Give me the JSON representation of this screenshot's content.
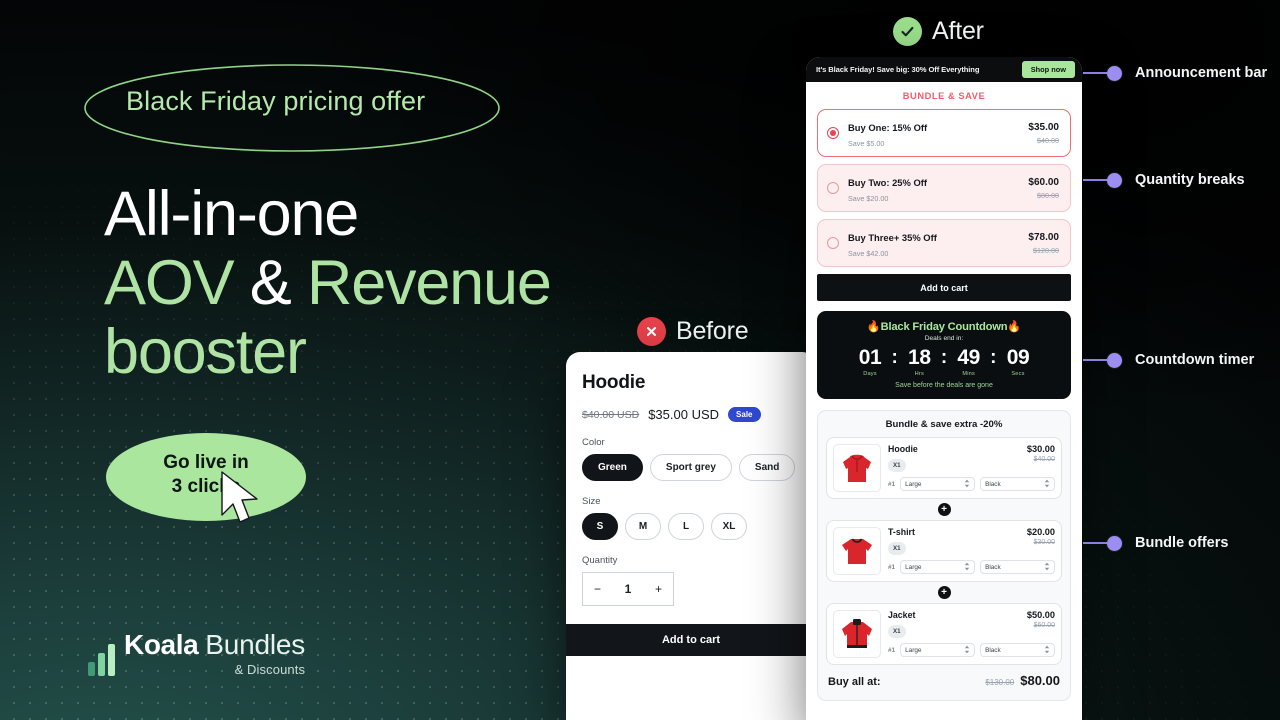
{
  "theme": {
    "bg_dark": "#050607",
    "bg_teal": "#23504a",
    "accent_green": "#abe69f",
    "accent_red": "#ee5f6a",
    "accent_purple": "#9c8ef0",
    "sale_blue": "#2e49cf"
  },
  "hero": {
    "eyebrow": "Black Friday pricing offer",
    "headline_line1": "All-in-one",
    "headline_line2a": "AOV",
    "headline_line2b": "&",
    "headline_line2c": "Revenue",
    "headline_line3": "booster",
    "pill_line1": "Go live in",
    "pill_line2": "3 clicks",
    "cursor_icon": "mouse-pointer-icon"
  },
  "logo": {
    "bars_icon": "bar-chart-icon",
    "brand_bold": "Koala",
    "brand_light": "Bundles",
    "sub": "& Discounts"
  },
  "labels": {
    "before": {
      "text": "Before",
      "icon": "x-circle-icon"
    },
    "after": {
      "text": "After",
      "icon": "check-circle-icon"
    }
  },
  "before_panel": {
    "product_title": "Hoodie",
    "price_old": "$40.00 USD",
    "price_new": "$35.00 USD",
    "sale_badge": "Sale",
    "color_label": "Color",
    "colors": [
      "Green",
      "Sport grey",
      "Sand"
    ],
    "color_selected": "Green",
    "size_label": "Size",
    "sizes": [
      "S",
      "M",
      "L",
      "XL"
    ],
    "size_selected": "S",
    "quantity_label": "Quantity",
    "quantity_minus": "−",
    "quantity_value": "1",
    "quantity_plus": "+",
    "add_to_cart": "Add to cart"
  },
  "after_panel": {
    "announcement": {
      "text": "It's Black Friday! Save big: 30% Off Everything",
      "cta": "Shop now"
    },
    "bundle_save_heading": "BUNDLE & SAVE",
    "tiers": [
      {
        "name": "Buy One: 15% Off",
        "save": "Save $5.00",
        "price": "$35.00",
        "old": "$40.00",
        "selected": true
      },
      {
        "name": "Buy Two: 25% Off",
        "save": "Save $20.00",
        "price": "$60.00",
        "old": "$80.00",
        "selected": false
      },
      {
        "name": "Buy Three+ 35% Off",
        "save": "Save $42.00",
        "price": "$78.00",
        "old": "$120.00",
        "selected": false
      }
    ],
    "add_to_cart": "Add to cart",
    "countdown": {
      "title": "🔥Black Friday Countdown🔥",
      "subtitle": "Deals end in:",
      "days": "01",
      "hrs": "18",
      "mins": "49",
      "secs": "09",
      "unit_days": "Days",
      "unit_hrs": "Hrs",
      "unit_mins": "Mins",
      "unit_secs": "Secs",
      "footer": "Save before the deals are gone",
      "colon": ":"
    },
    "bundle": {
      "heading": "Bundle & save extra -20%",
      "items": [
        {
          "name": "Hoodie",
          "price": "$30.00",
          "old": "$40.00",
          "qty": "X1",
          "index": "#1",
          "size": "Large",
          "color": "Black",
          "thumb": "red-hoodie-image"
        },
        {
          "name": "T-shirt",
          "price": "$20.00",
          "old": "$30.00",
          "qty": "X1",
          "index": "#1",
          "size": "Large",
          "color": "Black",
          "thumb": "red-tshirt-image"
        },
        {
          "name": "Jacket",
          "price": "$50.00",
          "old": "$60.00",
          "qty": "X1",
          "index": "#1",
          "size": "Large",
          "color": "Black",
          "thumb": "red-jacket-image"
        }
      ],
      "plus_glyph": "+",
      "buy_all_label": "Buy all at:",
      "buy_all_old": "$130.00",
      "buy_all_new": "$80.00"
    }
  },
  "annotations": [
    {
      "text": "Announcement bar"
    },
    {
      "text": "Quantity breaks"
    },
    {
      "text": "Countdown timer"
    },
    {
      "text": "Bundle offers"
    }
  ]
}
